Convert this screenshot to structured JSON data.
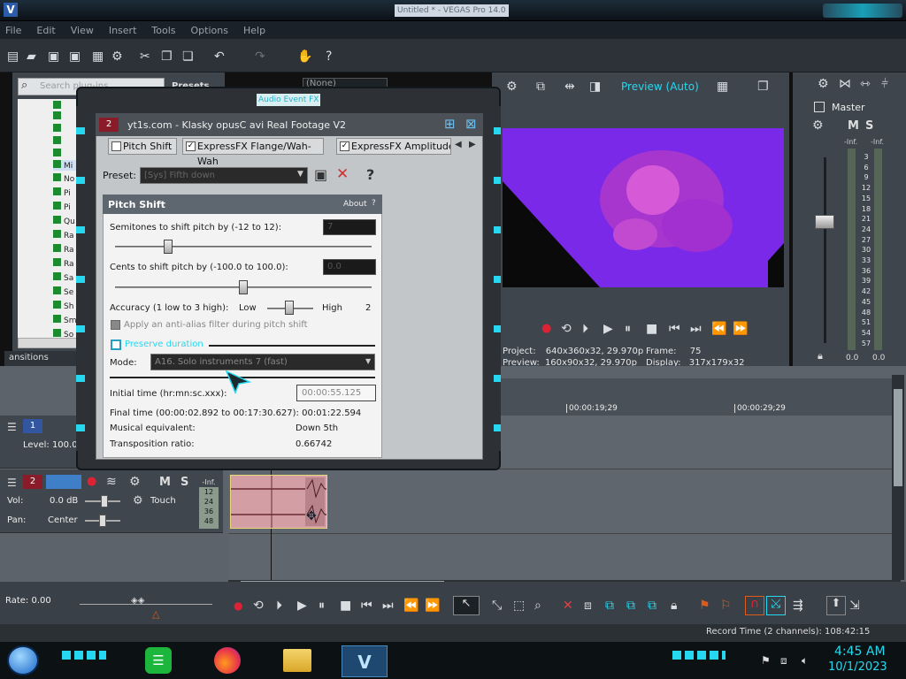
{
  "app": {
    "title": "Untitled * - VEGAS Pro 14.0"
  },
  "menu": [
    "File",
    "Edit",
    "View",
    "Insert",
    "Tools",
    "Options",
    "Help"
  ],
  "explorer": {
    "search_placeholder": "Search plug-ins",
    "presets_label": "Presets",
    "tree_rows": [
      "",
      "",
      "",
      "",
      "",
      "Mi",
      "No",
      "Pi",
      "Pi",
      "Qu",
      "Ra",
      "Ra",
      "Ra",
      "Sa",
      "Se",
      "Sh",
      "Sm",
      "So"
    ],
    "tab_label": "ansitions"
  },
  "dialog": {
    "title": "Audio Event FX",
    "track_number": "2",
    "event_name": "yt1s.com - Klasky opusC avi Real Footage V2",
    "fx_tabs": [
      "Pitch Shift",
      "ExpressFX Flange/Wah-Wah",
      "ExpressFX Amplitude"
    ],
    "preset_label": "Preset:",
    "preset_value": "[Sys] Fifth down",
    "plugin_title": "Pitch Shift",
    "about_label": "About",
    "semitones_label": "Semitones to shift pitch by (-12 to 12):",
    "semitones_value": 7,
    "cents_label": "Cents to shift pitch by (-100.0 to 100.0):",
    "cents_value": 0.0,
    "accuracy_label": "Accuracy (1 low to 3 high):",
    "accuracy_low": "Low",
    "accuracy_high": "High",
    "accuracy_value": "2",
    "antialias_label": "Apply an anti-alias filter during pitch shift",
    "preserve_label": "Preserve duration",
    "mode_label": "Mode:",
    "mode_value": "A16. Solo instruments 7 (fast)",
    "initial_time_label": "Initial time (hr:mn:sc.xxx):",
    "initial_time_value": "00:00:55.125",
    "final_time": "Final time (00:00:02.892 to 00:17:30.627): 00:01:22.594",
    "musical_equiv_label": "Musical equivalent:",
    "musical_equiv_value": "Down 5th",
    "transposition_label": "Transposition ratio:",
    "transposition_value": "0.66742"
  },
  "preview": {
    "mode_label": "Preview (Auto)",
    "preset_dropdown": "(None)",
    "project_label": "Project:",
    "project_value": "640x360x32, 29.970p",
    "preview_label": "Preview:",
    "preview_value": "160x90x32, 29.970p",
    "frame_label": "Frame:",
    "frame_value": "75",
    "display_label": "Display:",
    "display_value": "317x179x32"
  },
  "master": {
    "title": "Master",
    "m": "M",
    "s": "S",
    "inf_left": "-Inf.",
    "inf_right": "-Inf.",
    "scale": [
      "3",
      "6",
      "9",
      "12",
      "15",
      "18",
      "21",
      "24",
      "27",
      "30",
      "33",
      "36",
      "39",
      "42",
      "45",
      "48",
      "51",
      "54",
      "57"
    ],
    "level_left": "0.0",
    "level_right": "0.0"
  },
  "timeline": {
    "ruler_marks": [
      "00:00:19;29",
      "00:00:29;29"
    ],
    "video_track_number": "1",
    "video_level": "Level: 100.0",
    "audio_track_number": "2",
    "vol_label": "Vol:",
    "vol_value": "0.0 dB",
    "pan_label": "Pan:",
    "pan_value": "Center",
    "touch_label": "Touch",
    "meter_inf": "-Inf.",
    "meter_scale": [
      "12",
      "24",
      "36",
      "48"
    ],
    "m": "M",
    "s": "S"
  },
  "transport": {
    "rate_label": "Rate: 0.00"
  },
  "status": {
    "record_time": "Record Time (2 channels): 108:42:15"
  },
  "taskbar": {
    "time": "4:45 AM",
    "date": "10/1/2023"
  },
  "colors": {
    "accent": "#25d8ef",
    "video_purple": "#7a29e8",
    "clip_pink": "#d49ea5"
  }
}
